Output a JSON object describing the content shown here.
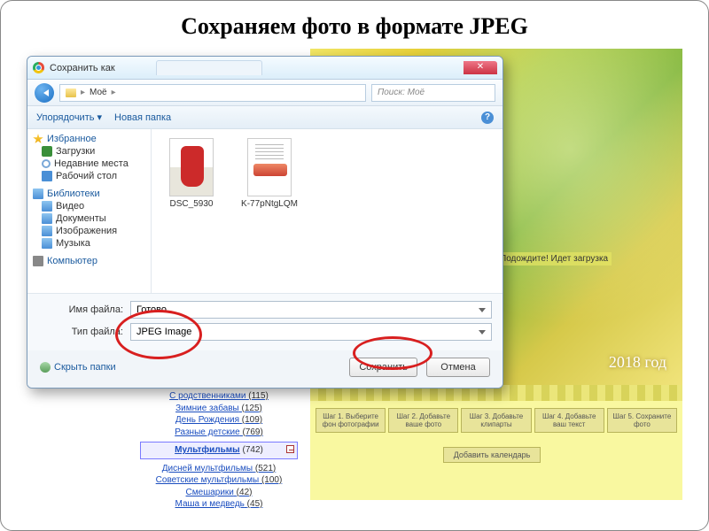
{
  "slide": {
    "title": "Сохраняем фото в формате JPEG"
  },
  "dialog": {
    "title": "Сохранить как",
    "tab_ghost": "",
    "breadcrumb": {
      "root_icon": "folder",
      "path": "Моё",
      "arrow": "▸"
    },
    "search": {
      "placeholder": "Поиск: Моё"
    },
    "toolbar": {
      "organize": "Упорядочить ▾",
      "new_folder": "Новая папка"
    },
    "sidebar": {
      "favorites": {
        "label": "Избранное",
        "items": [
          "Загрузки",
          "Недавние места",
          "Рабочий стол"
        ]
      },
      "libraries": {
        "label": "Библиотеки",
        "items": [
          "Видео",
          "Документы",
          "Изображения",
          "Музыка"
        ]
      },
      "computer": {
        "label": "Компьютер"
      }
    },
    "files": [
      {
        "name": "DSC_5930"
      },
      {
        "name": "K-77pNtgLQM"
      }
    ],
    "fields": {
      "filename_label": "Имя файла:",
      "filename_value": "Готово",
      "filetype_label": "Тип файла:",
      "filetype_value": "JPEG Image"
    },
    "footer": {
      "hide_folders": "Скрыть папки",
      "save": "Сохранить",
      "cancel": "Отмена"
    }
  },
  "site": {
    "wait_text": "Подождите!\nИдет загрузка",
    "year": "2018 год",
    "steps": [
      "Шаг 1. Выберите фон фотографии",
      "Шаг 2. Добавьте ваше фото",
      "Шаг 3. Добавьте клипарты",
      "Шаг 4. Добавьте ваш текст",
      "Шаг 5. Сохраните фото"
    ],
    "add_calendar": "Добавить календарь"
  },
  "links": {
    "top": [
      {
        "t": "С родственниками",
        "n": "(115)"
      },
      {
        "t": "Зимние забавы",
        "n": "(125)"
      },
      {
        "t": "День Рождения",
        "n": "(109)"
      },
      {
        "t": "Разные детские",
        "n": "(769)"
      }
    ],
    "category": {
      "t": "Мультфильмы",
      "n": "(742)"
    },
    "sub": [
      {
        "t": "Дисней мультфильмы",
        "n": "(521)"
      },
      {
        "t": "Советские мультфильмы",
        "n": "(100)"
      },
      {
        "t": "Смешарики",
        "n": "(42)"
      },
      {
        "t": "Маша и медведь",
        "n": "(45)"
      }
    ]
  }
}
